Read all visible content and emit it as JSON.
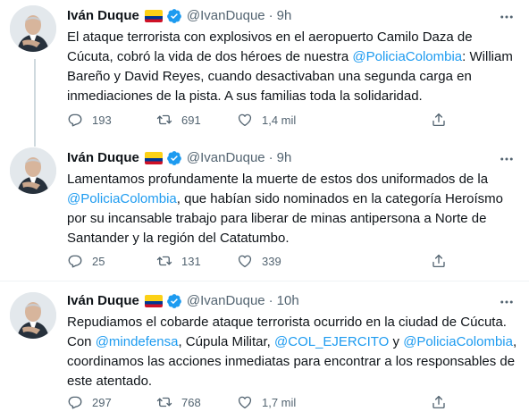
{
  "colors": {
    "accent": "#1d9bf0",
    "text": "#0f1419",
    "muted": "#536471",
    "thread_line": "#cfd9de"
  },
  "tweets": [
    {
      "name": "Iván Duque",
      "handle": "@IvanDuque",
      "sep": "·",
      "time": "9h",
      "text": [
        "El ataque terrorista con explosivos en el aeropuerto Camilo Daza de Cúcuta, cobró la vida de dos héroes de nuestra ",
        "@PoliciaColombia",
        ": William Bareño y David Reyes, cuando desactivaban una segunda carga en inmediaciones de la pista. A sus familias toda la solidaridad."
      ],
      "replies": "193",
      "retweets": "691",
      "likes": "1,4 mil"
    },
    {
      "name": "Iván Duque",
      "handle": "@IvanDuque",
      "sep": "·",
      "time": "9h",
      "text": [
        "Lamentamos profundamente la muerte de estos dos uniformados de la ",
        "@PoliciaColombia",
        ", que habían sido nominados en la categoría Heroísmo por su incansable trabajo para liberar de minas antipersona a Norte de Santander y la región del Catatumbo."
      ],
      "replies": "25",
      "retweets": "131",
      "likes": "339"
    },
    {
      "name": "Iván Duque",
      "handle": "@IvanDuque",
      "sep": "·",
      "time": "10h",
      "text": [
        "Repudiamos el cobarde ataque terrorista ocurrido en la ciudad de Cúcuta. Con ",
        "@mindefensa",
        ", Cúpula Militar, ",
        "@COL_EJERCITO",
        " y ",
        "@PoliciaColombia",
        ", coordinamos las acciones inmediatas para encontrar a los responsables de este atentado."
      ],
      "replies": "297",
      "retweets": "768",
      "likes": "1,7 mil"
    }
  ]
}
